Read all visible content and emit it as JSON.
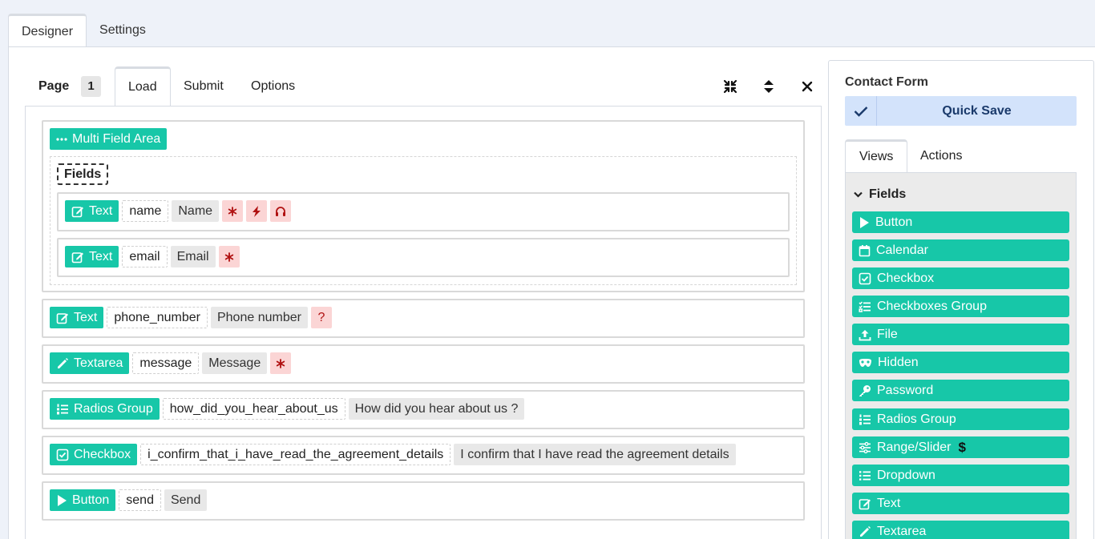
{
  "top_tabs": [
    {
      "label": "Designer",
      "active": true
    },
    {
      "label": "Settings",
      "active": false
    }
  ],
  "page_bar": {
    "page_label": "Page",
    "page_number": "1",
    "tabs": [
      {
        "label": "Load",
        "active": true
      },
      {
        "label": "Submit",
        "active": false
      },
      {
        "label": "Options",
        "active": false
      }
    ],
    "tool_icons": [
      "compress-icon",
      "sort-icon",
      "close-icon"
    ]
  },
  "multi_field_area": {
    "label": "Multi Field Area",
    "fields_label": "Fields",
    "rows": [
      {
        "type": "Text",
        "name": "name",
        "label": "Name",
        "badges": [
          "asterisk-icon",
          "bolt-icon",
          "headset-icon"
        ]
      },
      {
        "type": "Text",
        "name": "email",
        "label": "Email",
        "badges": [
          "asterisk-icon"
        ]
      }
    ]
  },
  "rows": [
    {
      "type": "Text",
      "icon": "edit-icon",
      "name": "phone_number",
      "label": "Phone number",
      "badge_text": "?"
    },
    {
      "type": "Textarea",
      "icon": "pencil-icon",
      "name": "message",
      "label": "Message",
      "badge_text": "*"
    },
    {
      "type": "Radios Group",
      "icon": "list-ol-icon",
      "name": "how_did_you_hear_about_us",
      "label": "How did you hear about us ?",
      "badge_text": ""
    },
    {
      "type": "Checkbox",
      "icon": "check-square-icon",
      "name": "i_confirm_that_i_have_read_the_agreement_details",
      "label": "I confirm that I have read the agreement details",
      "badge_text": ""
    },
    {
      "type": "Button",
      "icon": "play-icon",
      "name": "send",
      "label": "Send",
      "badge_text": ""
    }
  ],
  "panel": {
    "title": "Contact Form",
    "quick_save": "Quick Save",
    "tabs": [
      {
        "label": "Views",
        "active": true
      },
      {
        "label": "Actions",
        "active": false
      }
    ],
    "fields_heading": "Fields",
    "items": [
      {
        "label": "Button",
        "icon": "play-icon"
      },
      {
        "label": "Calendar",
        "icon": "calendar-icon"
      },
      {
        "label": "Checkbox",
        "icon": "check-square-icon"
      },
      {
        "label": "Checkboxes Group",
        "icon": "tasks-icon"
      },
      {
        "label": "File",
        "icon": "upload-icon"
      },
      {
        "label": "Hidden",
        "icon": "mask-icon"
      },
      {
        "label": "Password",
        "icon": "key-icon"
      },
      {
        "label": "Radios Group",
        "icon": "list-ol-icon"
      },
      {
        "label": "Range/Slider",
        "icon": "sliders-icon",
        "extra": "$"
      },
      {
        "label": "Dropdown",
        "icon": "list-icon"
      },
      {
        "label": "Text",
        "icon": "edit-icon"
      },
      {
        "label": "Textarea",
        "icon": "pencil-icon"
      }
    ]
  },
  "colors": {
    "accent": "#17c7a8",
    "badge_bg": "#fbd5d5",
    "badge_fg": "#b01111",
    "quick_save_bg": "#d3e3fb"
  }
}
